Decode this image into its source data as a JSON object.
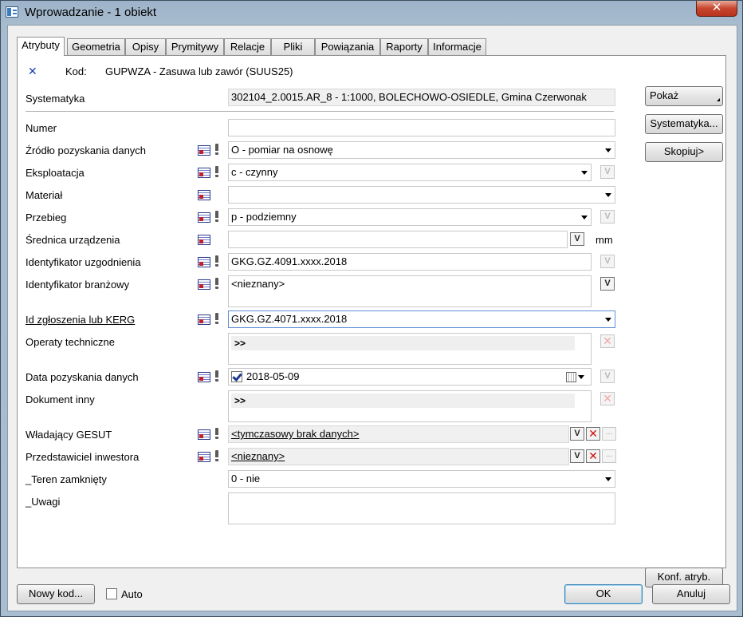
{
  "window": {
    "title": "Wprowadzanie - 1 obiekt",
    "close_glyph": "✕"
  },
  "tabs": [
    "Atrybuty",
    "Geometria",
    "Opisy",
    "Prymitywy",
    "Relacje",
    "Pliki",
    "Powiązania",
    "Raporty",
    "Informacje"
  ],
  "header": {
    "kod_label": "Kod:",
    "kod_value": "GUPWZA - Zasuwa lub zawór (SUUS25)"
  },
  "systematyka": {
    "label": "Systematyka",
    "value": "302104_2.0015.AR_8 - 1:1000, BOLECHOWO-OSIEDLE, Gmina Czerwonak"
  },
  "fields": {
    "numer": {
      "label": "Numer",
      "value": ""
    },
    "zrodlo": {
      "label": "Źródło pozyskania danych",
      "value": "O - pomiar na osnowę"
    },
    "eksploatacja": {
      "label": "Eksploatacja",
      "value": "c - czynny"
    },
    "material": {
      "label": "Materiał",
      "value": ""
    },
    "przebieg": {
      "label": "Przebieg",
      "value": "p - podziemny"
    },
    "srednica": {
      "label": "Średnica urządzenia",
      "value": "",
      "unit": "mm"
    },
    "id_uzgodnienia": {
      "label": "Identyfikator uzgodnienia",
      "value": "GKG.GZ.4091.xxxx.2018"
    },
    "id_branzowy": {
      "label": "Identyfikator branżowy",
      "value": "<nieznany>"
    },
    "id_zgloszenia": {
      "label": "Id zgłoszenia lub KERG",
      "value": "GKG.GZ.4071.xxxx.2018"
    },
    "operaty": {
      "label": "Operaty techniczne",
      "value": ">>"
    },
    "data": {
      "label": "Data pozyskania danych",
      "value": "2018-05-09"
    },
    "dokument": {
      "label": "Dokument inny",
      "value": ">>"
    },
    "wladajacy": {
      "label": "Władający GESUT",
      "value": "<tymczasowy brak danych>"
    },
    "przedstawiciel": {
      "label": "Przedstawiciel inwestora",
      "value": "<nieznany>"
    },
    "teren": {
      "label": "_Teren zamknięty",
      "value": "0 - nie"
    },
    "uwagi": {
      "label": "_Uwagi",
      "value": ""
    }
  },
  "side_buttons": {
    "pokaz": "Pokaż",
    "systematyka": "Systematyka...",
    "skopiuj": "Skopiuj>",
    "konf": "Konf. atryb."
  },
  "bottom": {
    "nowy_kod": "Nowy kod...",
    "auto": "Auto",
    "ok": "OK",
    "anuluj": "Anuluj"
  },
  "glyphs": {
    "v": "V",
    "x": "✕",
    "dots": "..."
  }
}
